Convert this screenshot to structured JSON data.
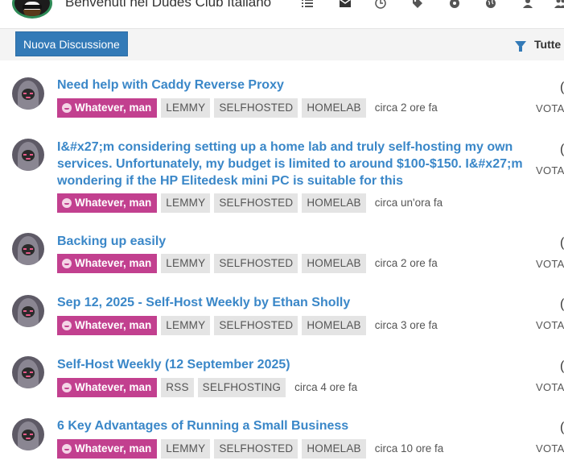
{
  "header": {
    "site_title": "Benvenuti nel Dudes Club Italiano",
    "nav_icons": [
      "list-icon",
      "inbox-icon",
      "clock-icon",
      "tags-icon",
      "popular-icon",
      "world-icon",
      "user-icon",
      "groups-icon"
    ]
  },
  "toolbar": {
    "new_topic_label": "Nuova Discussione",
    "filter_label": "Tutte"
  },
  "topics": [
    {
      "title": "Need help with Caddy Reverse Proxy",
      "category": "Whatever, man",
      "tags": [
        "LEMMY",
        "SELFHOSTED",
        "HOMELAB"
      ],
      "time": "circa 2 ore fa",
      "votes": "(",
      "votes_label": "VOTA"
    },
    {
      "title": "I&#x27;m considering setting up a home lab and truly self-hosting my own services. Unfortunately, my budget is limited to around $100-$150. I&#x27;m wondering if the HP Elitedesk mini PC is suitable for this",
      "category": "Whatever, man",
      "tags": [
        "LEMMY",
        "SELFHOSTED",
        "HOMELAB"
      ],
      "time": "circa un'ora fa",
      "votes": "(",
      "votes_label": "VOTA"
    },
    {
      "title": "Backing up easily",
      "category": "Whatever, man",
      "tags": [
        "LEMMY",
        "SELFHOSTED",
        "HOMELAB"
      ],
      "time": "circa 2 ore fa",
      "votes": "(",
      "votes_label": "VOTA"
    },
    {
      "title": "Sep 12, 2025 - Self-Host Weekly by Ethan Sholly",
      "category": "Whatever, man",
      "tags": [
        "LEMMY",
        "SELFHOSTED",
        "HOMELAB"
      ],
      "time": "circa 3 ore fa",
      "votes": "(",
      "votes_label": "VOTA"
    },
    {
      "title": "Self-Host Weekly (12 September 2025)",
      "category": "Whatever, man",
      "tags": [
        "RSS",
        "SELFHOSTING"
      ],
      "time": "circa 4 ore fa",
      "votes": "(",
      "votes_label": "VOTA"
    },
    {
      "title": "6 Key Advantages of Running a Small Business",
      "category": "Whatever, man",
      "tags": [
        "LEMMY",
        "SELFHOSTED",
        "HOMELAB"
      ],
      "time": "circa 10 ore fa",
      "votes": "(",
      "votes_label": "VOTA"
    }
  ]
}
